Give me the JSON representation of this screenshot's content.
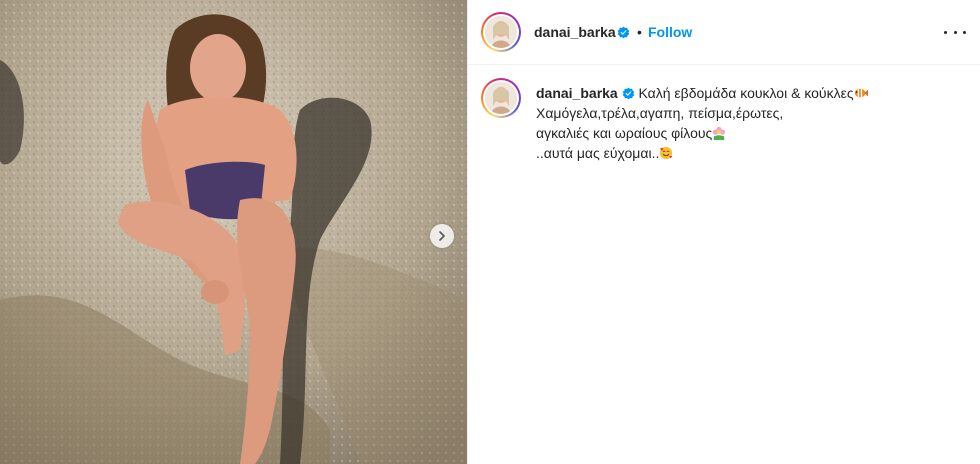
{
  "post": {
    "author": "danai_barka",
    "separator": "•",
    "follow_label": "Follow",
    "caption_lines": [
      "Καλή εβδομάδα κουκλοι & κούκλες",
      "Χαμόγελα,τρέλα,αγαπη, πείσμα,έρωτες,",
      "αγκαλιές και ωραίους φίλους",
      "..αυτά μας εύχομαι.."
    ],
    "caption_emojis": [
      "fish-emoji",
      "",
      "flower-emoji",
      "smiling-face-with-hearts-emoji"
    ]
  },
  "icons": {
    "verified": "verified-badge-icon",
    "more": "more-options-icon",
    "next": "chevron-right-icon"
  },
  "colors": {
    "accent": "#0095f6",
    "text": "#262626",
    "border": "#efefef"
  }
}
